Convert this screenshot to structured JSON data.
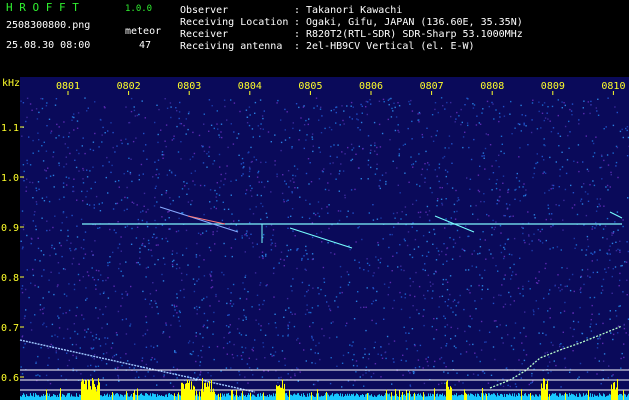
{
  "header": {
    "app_name": "H R O F F T",
    "version": "1.0.0",
    "file_name": "2508300800.png",
    "datetime": "25.08.30 08:00",
    "meteor_label": "meteor",
    "meteor_count": "47",
    "fields": [
      {
        "label": "Observer",
        "sep": ":",
        "value": "Takanori Kawachi"
      },
      {
        "label": "Receiving Location",
        "sep": ":",
        "value": "Ogaki, Gifu, JAPAN (136.60E, 35.35N)"
      },
      {
        "label": "Receiver",
        "sep": ":",
        "value": "R820T2(RTL-SDR) SDR-Sharp 53.1000MHz"
      },
      {
        "label": "Receiving antenna",
        "sep": ":",
        "value": "2el-HB9CV Vertical (el. E-W)"
      }
    ]
  },
  "spectrogram": {
    "y_unit": "kHz",
    "y_ticks": [
      "1.1",
      "1.0",
      "0.9",
      "0.8",
      "0.7",
      "0.6"
    ],
    "x_ticks": [
      "0801",
      "0802",
      "0803",
      "0804",
      "0805",
      "0806",
      "0807",
      "0808",
      "0809",
      "0810"
    ],
    "colors": {
      "background": "#0a0a5a",
      "label": "#ffff2a",
      "header_text": "#2ff02f",
      "signal": "#80f0ff",
      "bars": "#ffff00"
    }
  }
}
